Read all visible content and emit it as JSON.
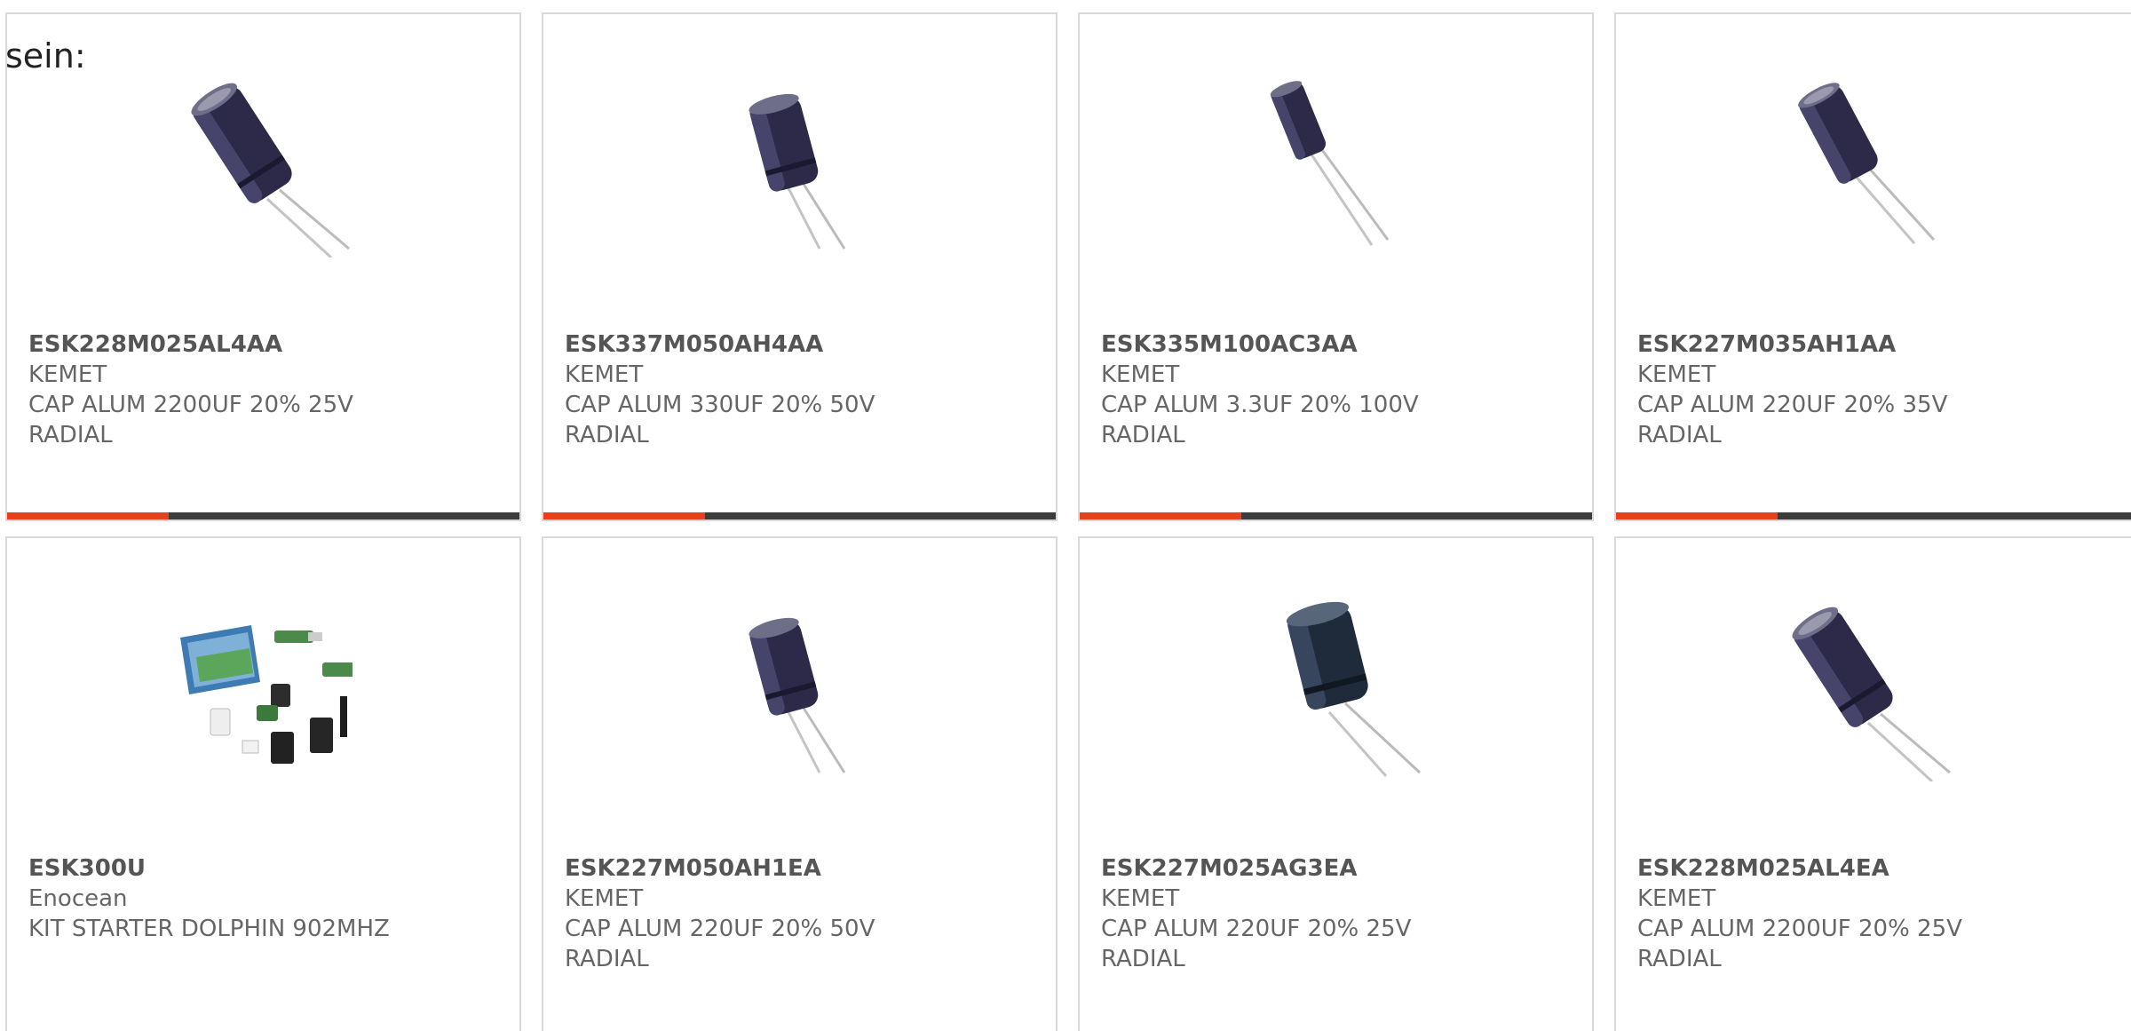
{
  "intro_text": "sein:",
  "colors": {
    "accent": "#e8401c",
    "bar_dark": "#3c3c3c",
    "border": "#d9d9d9",
    "text": "#666666"
  },
  "products": [
    {
      "part_number": "ESK228M025AL4AA",
      "manufacturer": "KEMET",
      "desc_line1": "CAP ALUM 2200UF 20% 25V",
      "desc_line2": "RADIAL",
      "image": "capacitor-icon"
    },
    {
      "part_number": "ESK337M050AH4AA",
      "manufacturer": "KEMET",
      "desc_line1": "CAP ALUM 330UF 20% 50V",
      "desc_line2": "RADIAL",
      "image": "capacitor-icon"
    },
    {
      "part_number": "ESK335M100AC3AA",
      "manufacturer": "KEMET",
      "desc_line1": "CAP ALUM 3.3UF 20% 100V",
      "desc_line2": "RADIAL",
      "image": "capacitor-icon"
    },
    {
      "part_number": "ESK227M035AH1AA",
      "manufacturer": "KEMET",
      "desc_line1": "CAP ALUM 220UF 20% 35V",
      "desc_line2": "RADIAL",
      "image": "capacitor-icon"
    },
    {
      "part_number": "ESK300U",
      "manufacturer": "Enocean",
      "desc_line1": "KIT STARTER DOLPHIN 902MHZ",
      "desc_line2": "",
      "image": "starter-kit-icon"
    },
    {
      "part_number": "ESK227M050AH1EA",
      "manufacturer": "KEMET",
      "desc_line1": "CAP ALUM 220UF 20% 50V",
      "desc_line2": "RADIAL",
      "image": "capacitor-icon"
    },
    {
      "part_number": "ESK227M025AG3EA",
      "manufacturer": "KEMET",
      "desc_line1": "CAP ALUM 220UF 20% 25V",
      "desc_line2": "RADIAL",
      "image": "capacitor-icon"
    },
    {
      "part_number": "ESK228M025AL4EA",
      "manufacturer": "KEMET",
      "desc_line1": "CAP ALUM 2200UF 20% 25V",
      "desc_line2": "RADIAL",
      "image": "capacitor-icon"
    }
  ]
}
